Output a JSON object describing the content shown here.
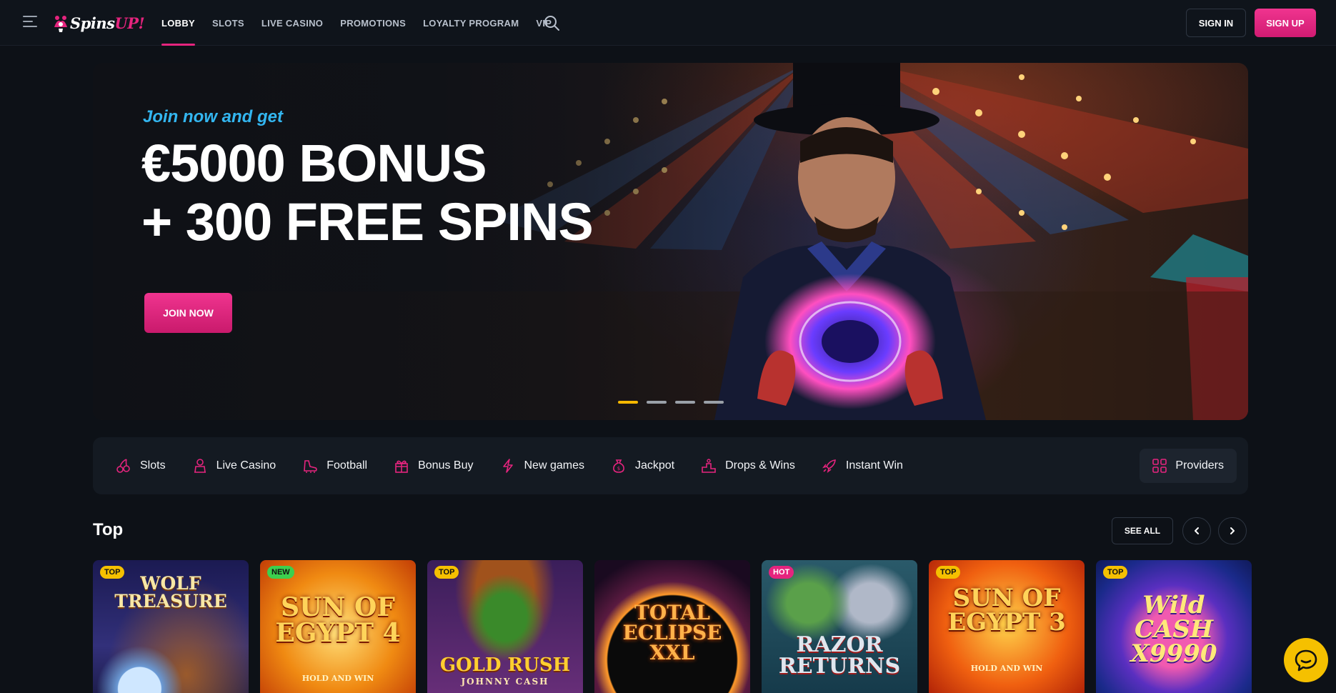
{
  "header": {
    "logo": {
      "part1": "Spins",
      "part2": "UP!"
    },
    "nav": [
      {
        "label": "LOBBY",
        "active": true
      },
      {
        "label": "SLOTS",
        "active": false
      },
      {
        "label": "LIVE CASINO",
        "active": false
      },
      {
        "label": "PROMOTIONS",
        "active": false
      },
      {
        "label": "LOYALTY PROGRAM",
        "active": false
      },
      {
        "label": "VIP",
        "active": false
      }
    ],
    "signin": "SIGN IN",
    "signup": "SIGN UP"
  },
  "hero": {
    "tagline": "Join now and get",
    "line1": "€5000 BONUS",
    "line2": "+ 300 FREE SPINS",
    "cta": "JOIN NOW",
    "slides": 4,
    "active_slide": 0
  },
  "categories": [
    {
      "label": "Slots",
      "icon": "cherries-icon"
    },
    {
      "label": "Live Casino",
      "icon": "dealer-icon"
    },
    {
      "label": "Football",
      "icon": "football-boot-icon"
    },
    {
      "label": "Bonus Buy",
      "icon": "gift-box-icon"
    },
    {
      "label": "New games",
      "icon": "lightning-icon"
    },
    {
      "label": "Jackpot",
      "icon": "money-bag-icon"
    },
    {
      "label": "Drops & Wins",
      "icon": "podium-icon"
    },
    {
      "label": "Instant Win",
      "icon": "rocket-icon"
    }
  ],
  "providers_label": "Providers",
  "top_section": {
    "title": "Top",
    "see_all": "SEE ALL",
    "games": [
      {
        "badge": "TOP",
        "title": "WOLF TREASURE"
      },
      {
        "badge": "NEW",
        "title": "SUN OF EGYPT 4",
        "subtitle": "HOLD AND WIN"
      },
      {
        "badge": "TOP",
        "title": "GOLD RUSH",
        "subtitle": "JOHNNY CASH"
      },
      {
        "badge": "",
        "title": "TOTAL ECLIPSE XXL"
      },
      {
        "badge": "HOT",
        "title": "RAZOR RETURNS"
      },
      {
        "badge": "TOP",
        "title": "SUN OF EGYPT 3",
        "subtitle": "HOLD AND WIN"
      },
      {
        "badge": "TOP",
        "title": "Wild CASH X9990"
      }
    ]
  },
  "colors": {
    "accent": "#e5247e",
    "tagline": "#33b6f0",
    "badge_top": "#f5c000",
    "badge_new": "#3ccf4e",
    "chat": "#f5c000"
  }
}
